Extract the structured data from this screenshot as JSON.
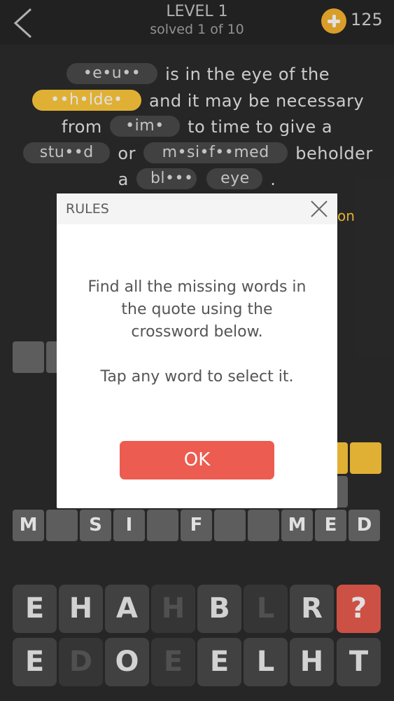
{
  "header": {
    "level": "LEVEL 1",
    "progress": "solved 1 of 10",
    "coins": "125"
  },
  "quote": {
    "words": {
      "beauty": "•e•u••",
      "beholder": "••h•lde•",
      "time": "•im•",
      "stupid": "stu••d",
      "misinformed": "m•si•f••med",
      "black": "bl•••",
      "eye": "eye"
    },
    "text": {
      "t1": "is in the eye of the",
      "t2": "and it may be necessary",
      "t3": "from",
      "t4": "to time to give a",
      "t5": "or",
      "t6": "beholder",
      "t7": "a",
      "t8": "."
    },
    "author_partial": "on"
  },
  "crossword": {
    "row_misinformed": [
      "M",
      "",
      "S",
      "I",
      "",
      "F",
      "",
      "",
      "M",
      "E",
      "D"
    ]
  },
  "keyboard": {
    "row1": [
      "E",
      "H",
      "A",
      "H",
      "B",
      "L",
      "R",
      "?"
    ],
    "row2": [
      "E",
      "D",
      "O",
      "E",
      "E",
      "L",
      "H",
      "T"
    ]
  },
  "modal": {
    "title": "RULES",
    "line1": "Find all the missing words in",
    "line2": "the quote using the",
    "line3": "crossword below.",
    "line4": "Tap any word to select it.",
    "ok_label": "OK"
  },
  "colors": {
    "background": "#2c2c2c",
    "accent_yellow": "#ffc93c",
    "hint_red": "#ea5c4e",
    "ok_button": "#ec5c50"
  }
}
